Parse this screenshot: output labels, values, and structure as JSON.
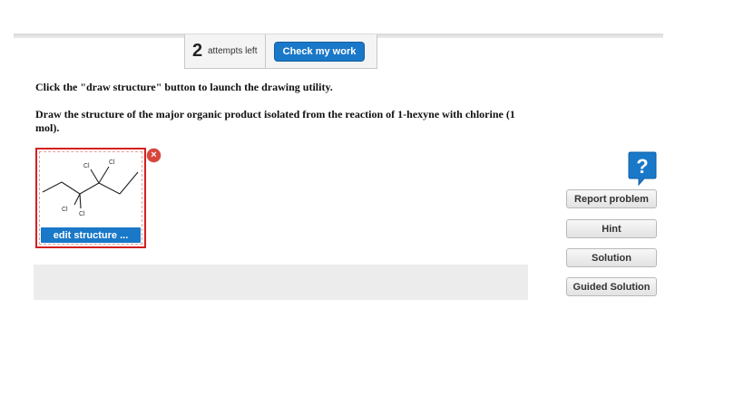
{
  "header": {
    "attempts_count": "2",
    "attempts_label": "attempts left",
    "check_label": "Check my work"
  },
  "question": {
    "instruction_1": "Click the \"draw structure\" button to launch the drawing utility.",
    "instruction_2": "Draw the structure of the major organic product isolated from the reaction of 1-hexyne with chlorine (1 mol)."
  },
  "structure": {
    "atom_label": "Cl",
    "edit_label": "edit structure ...",
    "close_symbol": "×",
    "border_color": "#d42020"
  },
  "sidebar": {
    "help_symbol": "?",
    "report_label": "Report problem",
    "hint_label": "Hint",
    "solution_label": "Solution",
    "guided_label": "Guided Solution"
  },
  "colors": {
    "accent_blue": "#1a78c8",
    "close_red": "#d9463d"
  }
}
